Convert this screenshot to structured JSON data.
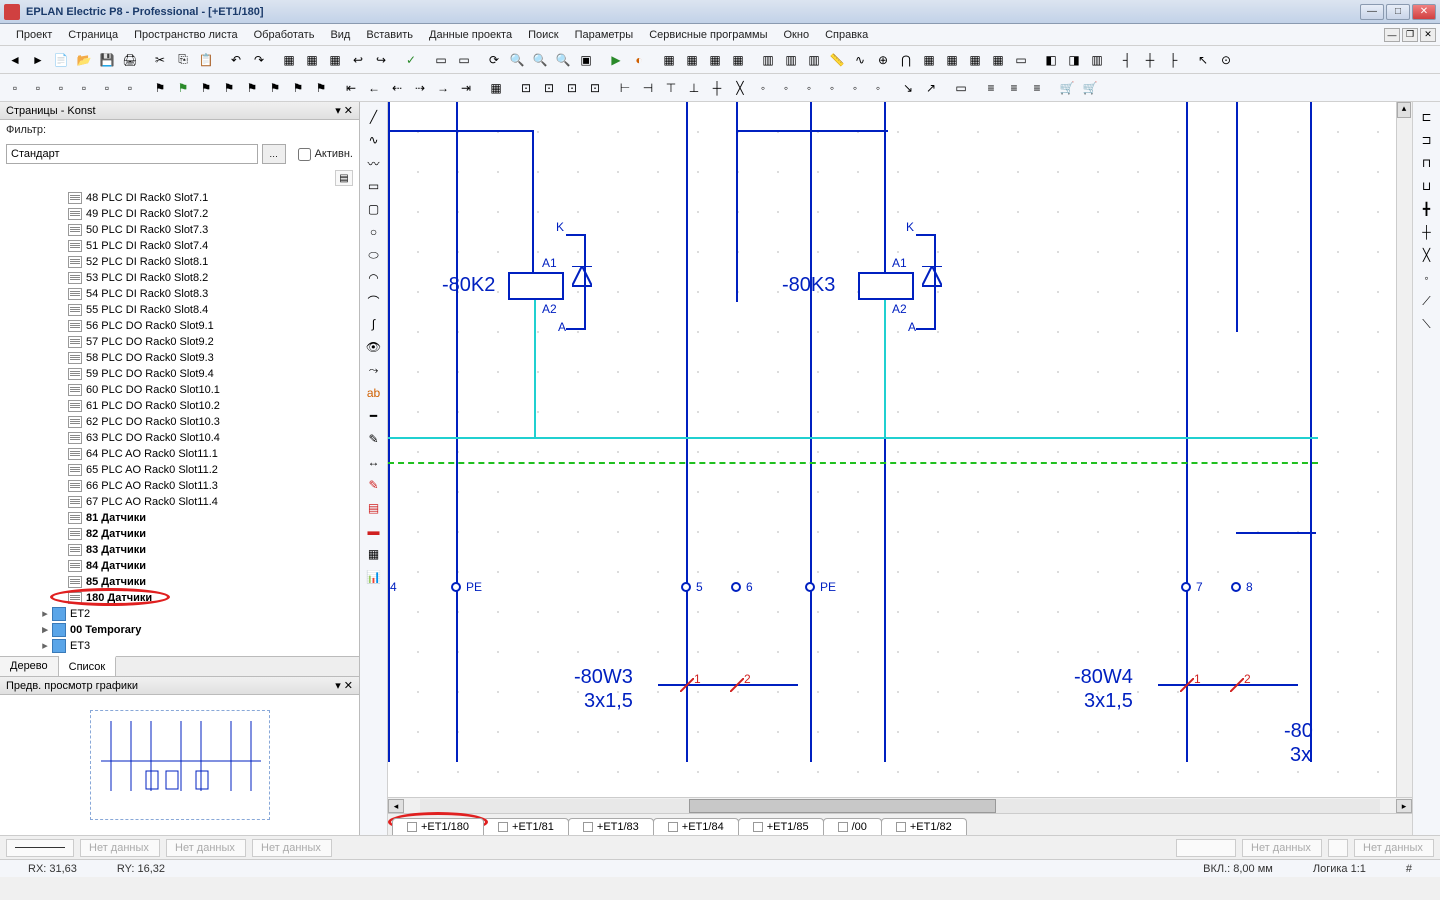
{
  "window": {
    "title": "EPLAN Electric P8 - Professional - [+ET1/180]"
  },
  "menu": {
    "items": [
      "Проект",
      "Страница",
      "Пространство листа",
      "Обработать",
      "Вид",
      "Вставить",
      "Данные проекта",
      "Поиск",
      "Параметры",
      "Сервисные программы",
      "Окно",
      "Справка"
    ]
  },
  "navigator": {
    "title": "Страницы - Konst",
    "filter_label": "Фильтр:",
    "filter_value": "Стандарт",
    "active_label": "Активн.",
    "tabs": {
      "tree": "Дерево",
      "list": "Список"
    },
    "items": [
      {
        "label": "48 PLC DI Rack0 Slot7.1",
        "bold": false
      },
      {
        "label": "49 PLC DI Rack0 Slot7.2",
        "bold": false
      },
      {
        "label": "50 PLC DI Rack0 Slot7.3",
        "bold": false
      },
      {
        "label": "51 PLC DI Rack0 Slot7.4",
        "bold": false
      },
      {
        "label": "52 PLC DI Rack0 Slot8.1",
        "bold": false
      },
      {
        "label": "53 PLC DI Rack0 Slot8.2",
        "bold": false
      },
      {
        "label": "54 PLC DI Rack0 Slot8.3",
        "bold": false
      },
      {
        "label": "55 PLC DI Rack0 Slot8.4",
        "bold": false
      },
      {
        "label": "56 PLC DO Rack0 Slot9.1",
        "bold": false
      },
      {
        "label": "57 PLC DO Rack0 Slot9.2",
        "bold": false
      },
      {
        "label": "58 PLC DO Rack0 Slot9.3",
        "bold": false
      },
      {
        "label": "59 PLC DO Rack0 Slot9.4",
        "bold": false
      },
      {
        "label": "60 PLC DO Rack0 Slot10.1",
        "bold": false
      },
      {
        "label": "61 PLC DO Rack0 Slot10.2",
        "bold": false
      },
      {
        "label": "62 PLC DO Rack0 Slot10.3",
        "bold": false
      },
      {
        "label": "63 PLC DO Rack0 Slot10.4",
        "bold": false
      },
      {
        "label": "64 PLC AO Rack0 Slot11.1",
        "bold": false
      },
      {
        "label": "65 PLC AO Rack0 Slot11.2",
        "bold": false
      },
      {
        "label": "66 PLC AO Rack0 Slot11.3",
        "bold": false
      },
      {
        "label": "67 PLC AO Rack0 Slot11.4",
        "bold": false
      },
      {
        "label": "81 Датчики",
        "bold": true
      },
      {
        "label": "82 Датчики",
        "bold": true
      },
      {
        "label": "83 Датчики",
        "bold": true
      },
      {
        "label": "84 Датчики",
        "bold": true
      },
      {
        "label": "85 Датчики",
        "bold": true
      },
      {
        "label": "180 Датчики",
        "bold": true,
        "selected": true,
        "highlighted": true
      }
    ],
    "nodes": [
      {
        "label": "ET2"
      },
      {
        "label": "00 Temporary",
        "bold": true
      },
      {
        "label": "ET3"
      }
    ]
  },
  "preview": {
    "title": "Предв. просмотр графики"
  },
  "page_tabs": [
    {
      "label": "+ET1/180",
      "active": true,
      "highlighted": true
    },
    {
      "label": "+ET1/81"
    },
    {
      "label": "+ET1/83"
    },
    {
      "label": "+ET1/84"
    },
    {
      "label": "+ET1/85"
    },
    {
      "label": "/00"
    },
    {
      "label": "+ET1/82"
    }
  ],
  "schematic": {
    "components": {
      "k2": {
        "name": "-80K2",
        "labels": {
          "K": "K",
          "A1": "A1",
          "A2": "A2",
          "A": "A"
        }
      },
      "k3": {
        "name": "-80K3",
        "labels": {
          "K": "K",
          "A1": "A1",
          "A2": "A2",
          "A": "A"
        }
      }
    },
    "terminals": {
      "t4": "4",
      "pe1": "PE",
      "t5": "5",
      "t6": "6",
      "pe2": "PE",
      "t7": "7",
      "t8": "8"
    },
    "cables": {
      "w3": {
        "name": "-80W3",
        "spec": "3x1,5",
        "cores": [
          "1",
          "2"
        ]
      },
      "w4": {
        "name": "-80W4",
        "spec": "3x1,5",
        "cores": [
          "1",
          "2"
        ]
      },
      "w5_partial": {
        "name": "-80",
        "spec": "3x"
      }
    }
  },
  "bottombar": {
    "nodata": "Нет данных"
  },
  "status": {
    "rx": "RX: 31,63",
    "ry": "RY: 16,32",
    "on": "ВКЛ.: 8,00 мм",
    "logic": "Логика 1:1",
    "hash": "#"
  }
}
